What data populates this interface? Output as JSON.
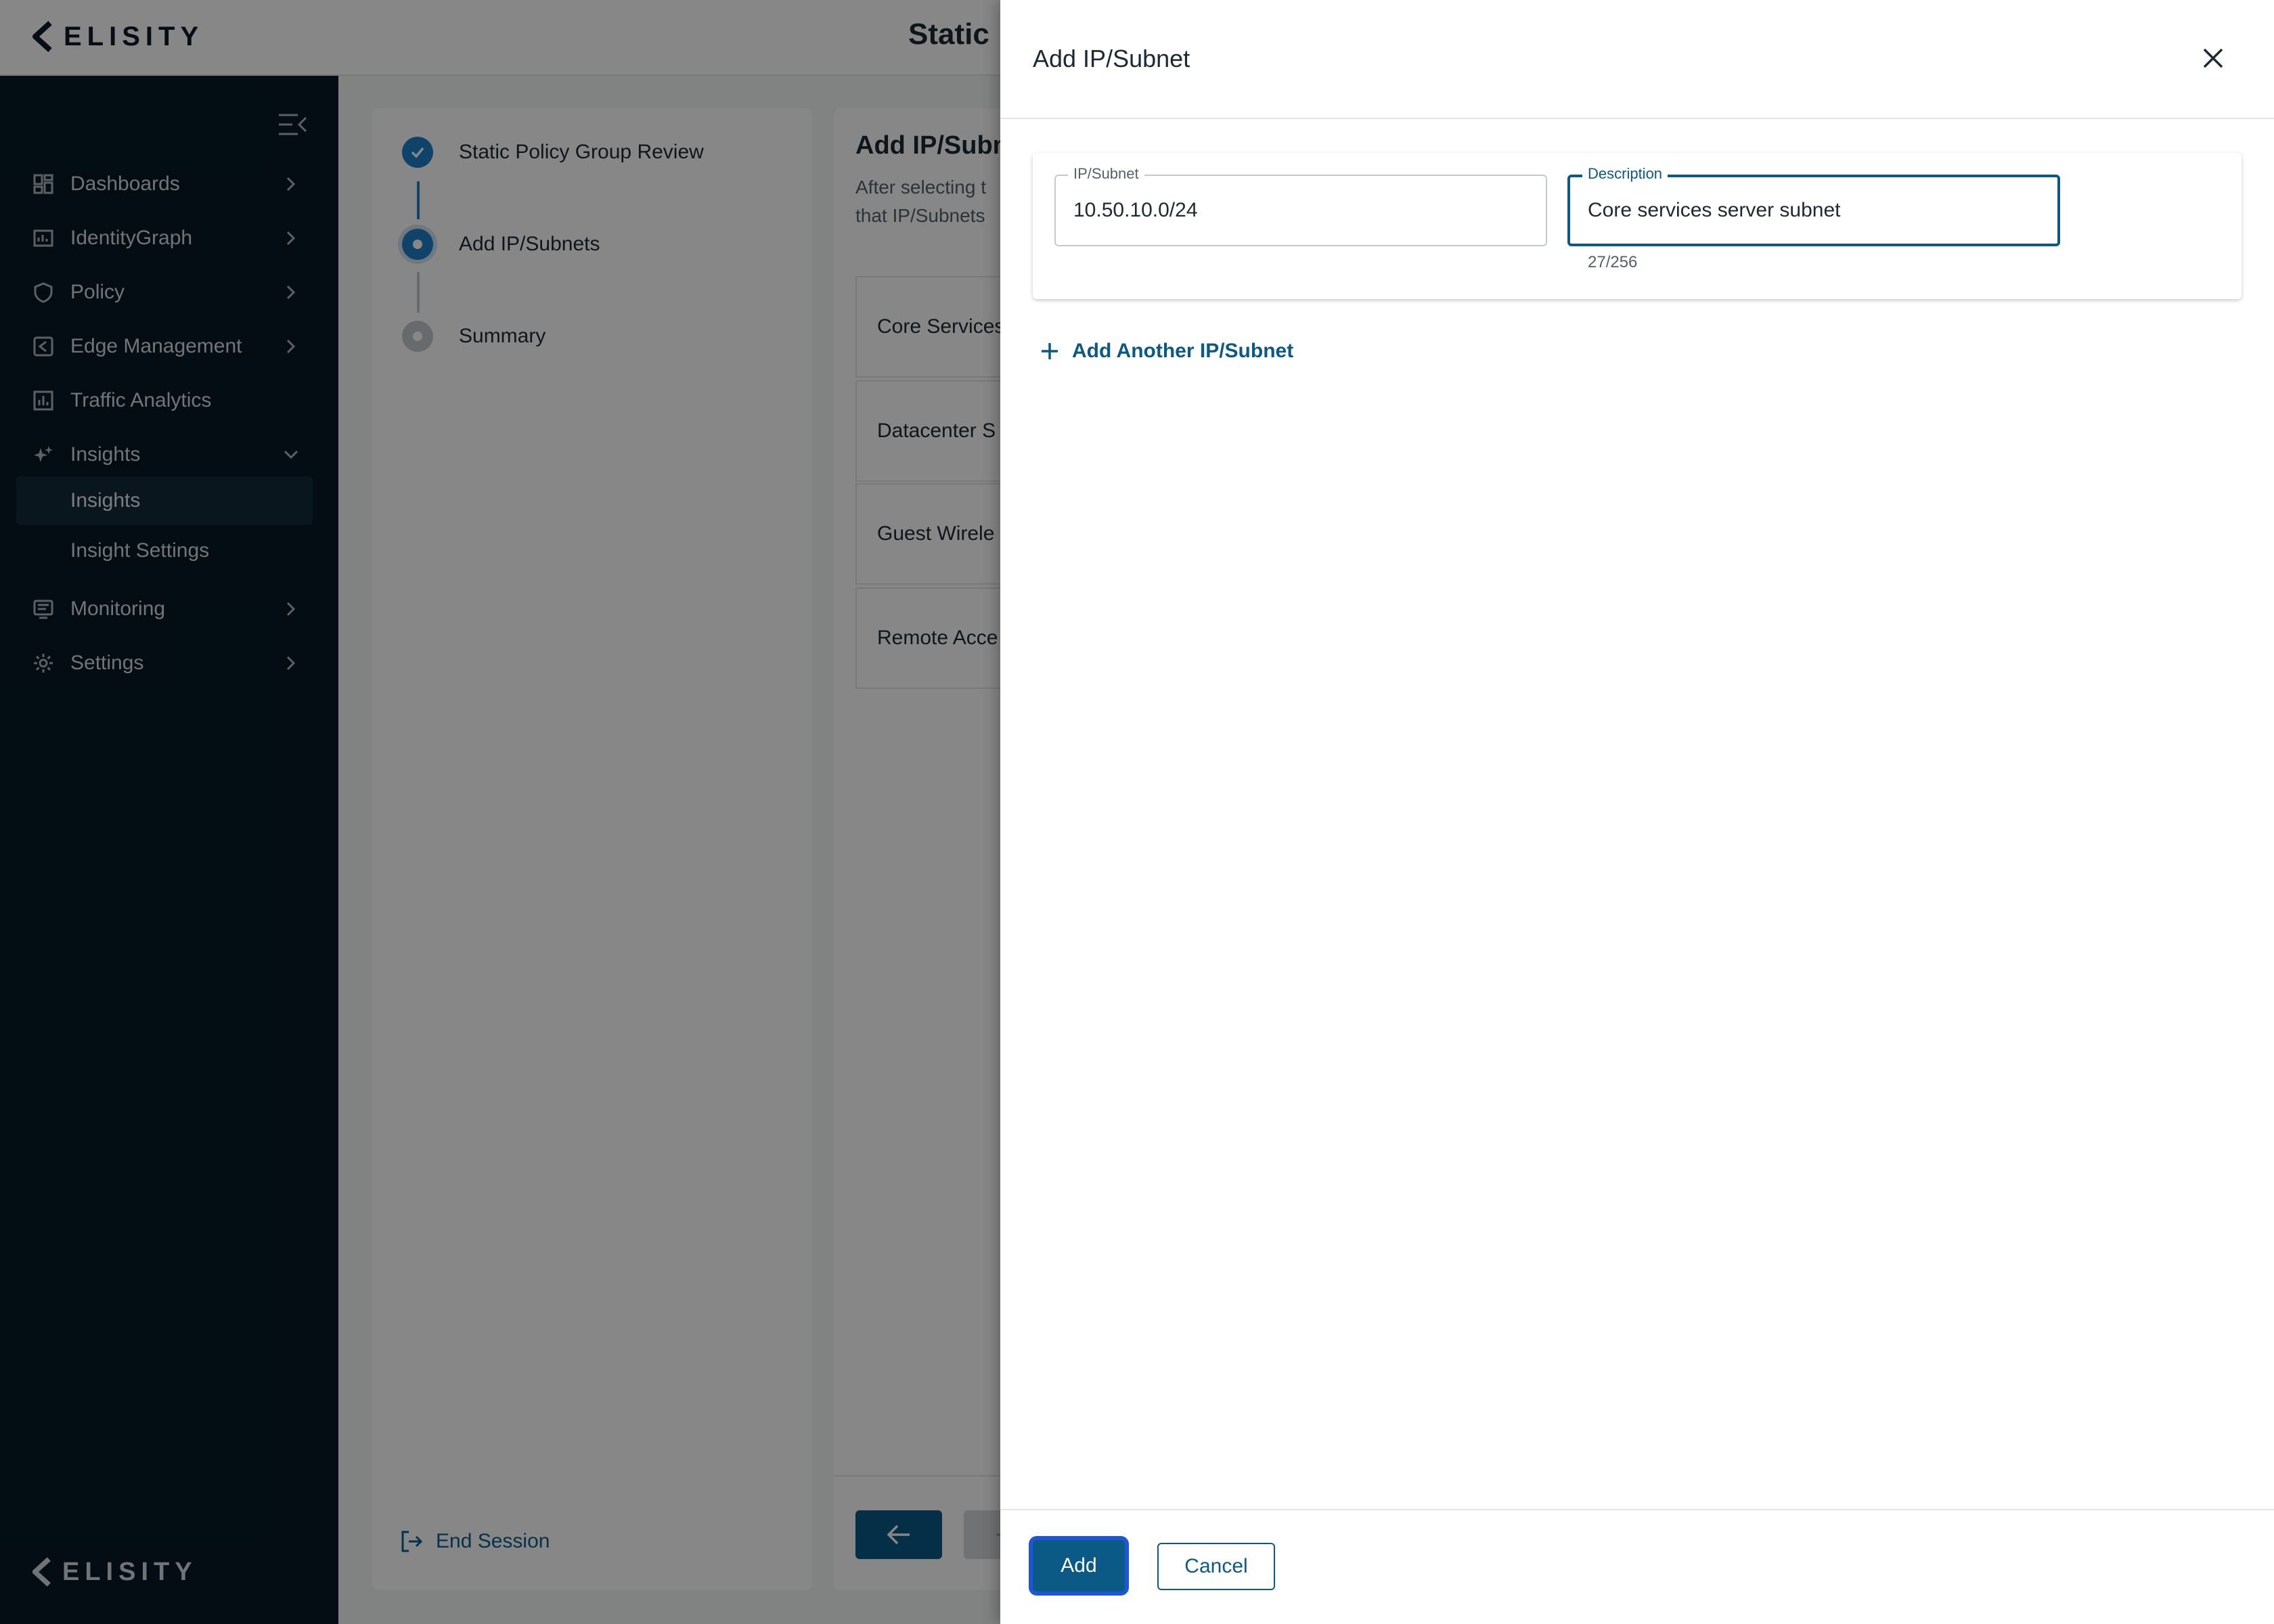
{
  "app": {
    "logo_text": "ELISITY",
    "page_title": "Static"
  },
  "sidebar": {
    "items": [
      {
        "label": "Dashboards",
        "icon": "dashboard-icon"
      },
      {
        "label": "IdentityGraph",
        "icon": "identity-graph-icon"
      },
      {
        "label": "Policy",
        "icon": "shield-icon"
      },
      {
        "label": "Edge Management",
        "icon": "edge-icon"
      },
      {
        "label": "Traffic Analytics",
        "icon": "bar-chart-icon"
      },
      {
        "label": "Insights",
        "icon": "sparkle-icon",
        "expanded": true
      },
      {
        "label": "Monitoring",
        "icon": "monitor-icon"
      },
      {
        "label": "Settings",
        "icon": "gear-icon"
      }
    ],
    "insights_children": [
      {
        "label": "Insights",
        "active": true
      },
      {
        "label": "Insight Settings",
        "active": false
      }
    ],
    "footer_logo": "ELISITY"
  },
  "stepper": {
    "steps": [
      {
        "label": "Static Policy Group Review",
        "status": "done"
      },
      {
        "label": "Add IP/Subnets",
        "status": "current"
      },
      {
        "label": "Summary",
        "status": "pending"
      }
    ],
    "end_session": "End Session"
  },
  "content": {
    "title": "Add IP/Subne",
    "description_line1": "After selecting t",
    "description_line2": "that IP/Subnets",
    "rows": [
      "Core Services",
      "Datacenter S",
      "Guest Wirele",
      "Remote Acce"
    ]
  },
  "drawer": {
    "title": "Add IP/Subnet",
    "ip_field": {
      "label": "IP/Subnet",
      "value": "10.50.10.0/24"
    },
    "description_field": {
      "label": "Description",
      "value": "Core services server subnet"
    },
    "counter": "27/256",
    "add_another": "Add Another IP/Subnet",
    "add_button": "Add",
    "cancel_button": "Cancel"
  },
  "colors": {
    "accent": "#0b5a85",
    "sidebar_bg": "#061925",
    "step_blue": "#1e7fc7",
    "focus_ring": "#1f56d8"
  }
}
